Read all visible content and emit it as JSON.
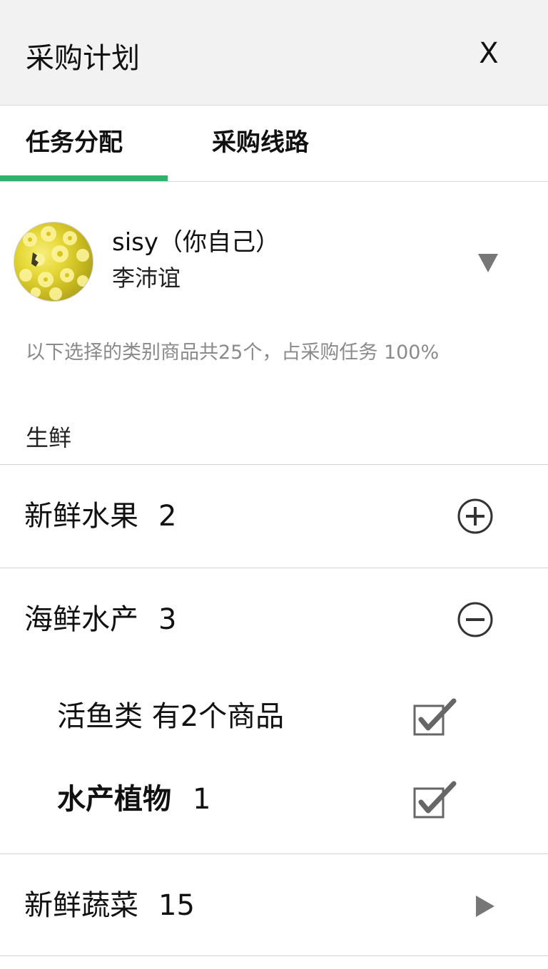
{
  "header": {
    "title": "采购计划",
    "close_label": "X"
  },
  "tabs": [
    {
      "label": "任务分配",
      "active": true
    },
    {
      "label": "采购线路",
      "active": false
    }
  ],
  "accent_color": "#2fb36c",
  "profile": {
    "name": "sisy（你自己）",
    "sub": "李沛谊",
    "avatar_icon": "yellow-flowers-avatar",
    "dropdown_icon": "triangle-down-icon"
  },
  "summary": "以下选择的类别商品共25个，占采购任务 100%",
  "section": {
    "label": "生鲜"
  },
  "categories": [
    {
      "name": "新鲜水果",
      "count": "2",
      "icon": "plus-circle-icon",
      "expanded": false
    },
    {
      "name": "海鲜水产",
      "count": "3",
      "icon": "minus-circle-icon",
      "expanded": true,
      "items": [
        {
          "label": "活鱼类 有2个商品",
          "count": "",
          "checked": true
        },
        {
          "label": "水产植物",
          "count": "1",
          "checked": true
        }
      ]
    },
    {
      "name": "新鲜蔬菜",
      "count": "15",
      "icon": "triangle-right-icon",
      "expanded": false
    }
  ]
}
